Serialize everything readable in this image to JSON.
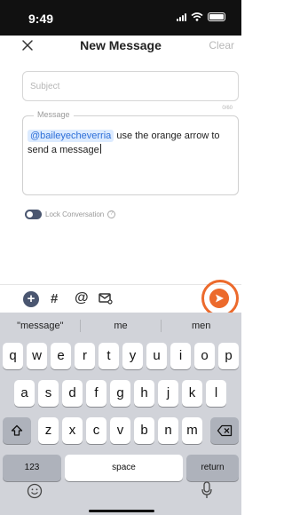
{
  "status_bar": {
    "time": "9:49"
  },
  "header": {
    "title": "New Message",
    "clear_label": "Clear"
  },
  "subject": {
    "placeholder": "Subject",
    "value": "",
    "counter": "0/60"
  },
  "message": {
    "legend": "Message",
    "mention": "@baileyecheverria",
    "text": " use the orange arrow to send a message"
  },
  "lock": {
    "label": "Lock Conversation",
    "enabled": false,
    "help_glyph": "?"
  },
  "toolbar": {
    "plus_glyph": "+",
    "hash_glyph": "#",
    "at_glyph": "@",
    "accent": "#ec6a2c"
  },
  "keyboard": {
    "suggestions": [
      "\"message\"",
      "me",
      "men"
    ],
    "row1": [
      "q",
      "w",
      "e",
      "r",
      "t",
      "y",
      "u",
      "i",
      "o",
      "p"
    ],
    "row2": [
      "a",
      "s",
      "d",
      "f",
      "g",
      "h",
      "j",
      "k",
      "l"
    ],
    "row3": [
      "z",
      "x",
      "c",
      "v",
      "b",
      "n",
      "m"
    ],
    "numbers_label": "123",
    "space_label": "space",
    "return_label": "return"
  }
}
